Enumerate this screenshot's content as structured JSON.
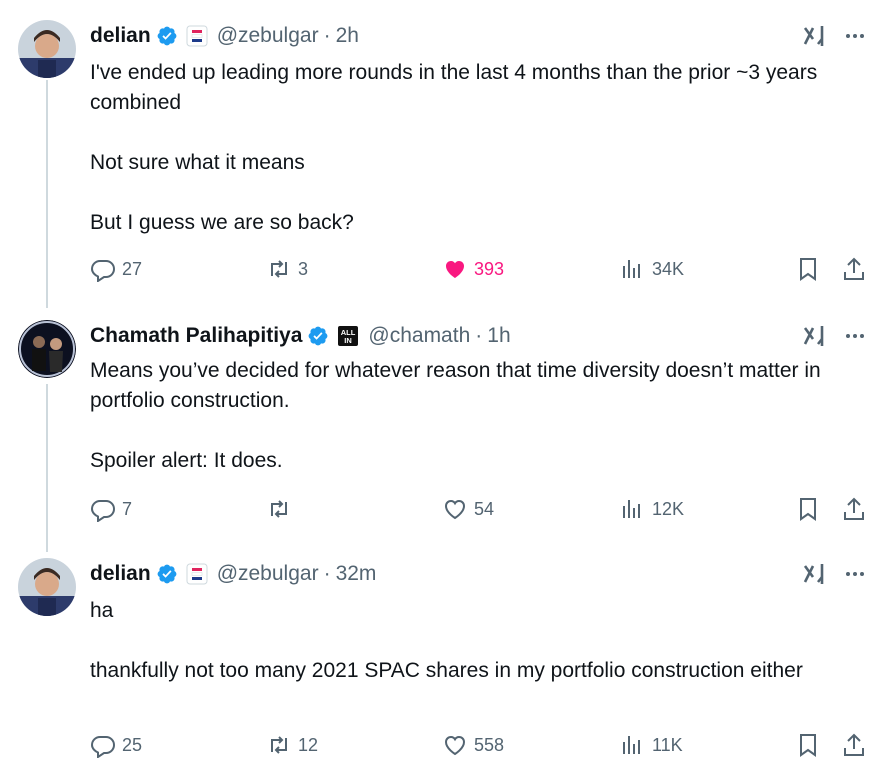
{
  "tweets": [
    {
      "name": "delian",
      "handle": "@zebulgar",
      "time": "2h",
      "body": [
        "I've ended up leading more rounds in the last 4 months than the prior ~3 years combined",
        "Not sure what it means",
        "But I guess we are so back?"
      ],
      "replies": "27",
      "reposts": "3",
      "likes": "393",
      "liked": true,
      "views": "34K"
    },
    {
      "name": "Chamath Palihapitiya",
      "handle": "@chamath",
      "time": "1h",
      "badge_text": "ALL IN",
      "body": [
        "Means you’ve decided for whatever reason that time diversity doesn’t matter in portfolio construction.",
        "Spoiler alert: It does."
      ],
      "replies": "7",
      "reposts": "",
      "likes": "54",
      "liked": false,
      "views": "12K"
    },
    {
      "name": "delian",
      "handle": "@zebulgar",
      "time": "32m",
      "body": [
        "ha",
        "thankfully not too many 2021 SPAC shares in my portfolio construction either"
      ],
      "replies": "25",
      "reposts": "12",
      "likes": "558",
      "liked": false,
      "views": "11K"
    }
  ],
  "separator": "·",
  "colors": {
    "verified": "#1d9bf0",
    "like_active": "#f91880",
    "muted": "#536471",
    "thread_line": "#cfd9de"
  },
  "icons": [
    "verified-icon",
    "flag-badge-icon",
    "grok-icon",
    "more-icon",
    "reply-icon",
    "repost-icon",
    "like-icon",
    "views-icon",
    "bookmark-icon",
    "share-icon"
  ]
}
